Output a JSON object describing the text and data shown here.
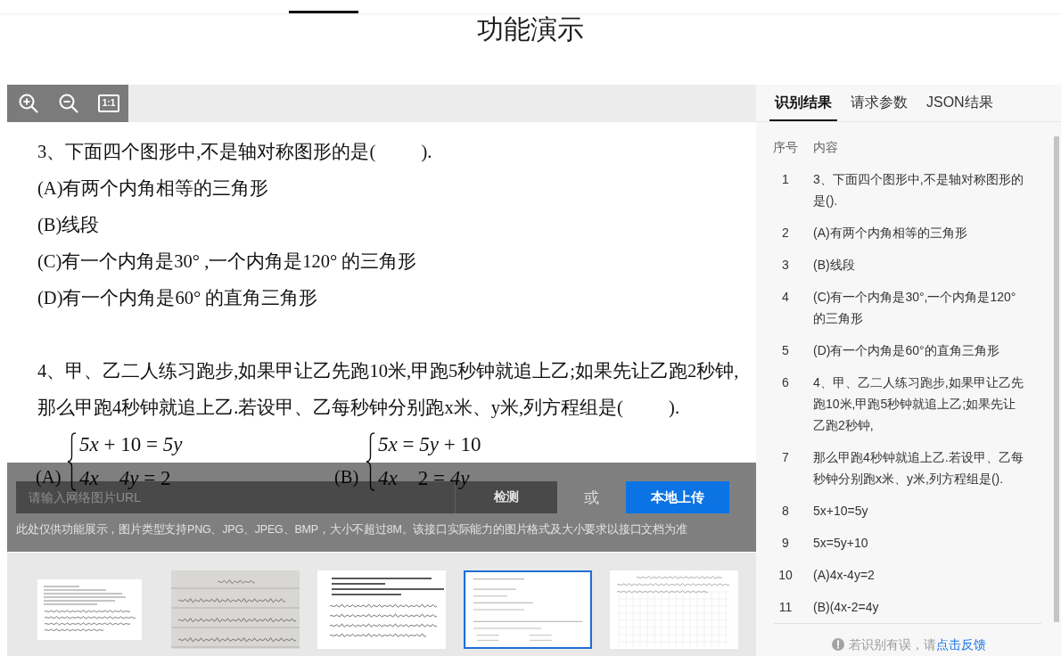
{
  "top_bar": {
    "active_tab_underline": true
  },
  "page_title": "功能演示",
  "viewer": {
    "toolbar": [
      {
        "kind": "zoom-in"
      },
      {
        "kind": "zoom-out"
      },
      {
        "kind": "actual-size",
        "label": "1:1"
      }
    ],
    "document": {
      "questions": [
        {
          "stem_lines": [
            "3、下面四个图形中,不是轴对称图形的是(          )."
          ],
          "options": [
            "(A)有两个内角相等的三角形",
            "(B)线段",
            "(C)有一个内角是30° ,一个内角是120° 的三角形",
            "(D)有一个内角是60° 的直角三角形"
          ]
        },
        {
          "stem_lines": [
            "4、甲、乙二人练习跑步,如果甲让乙先跑10米,甲跑5秒钟就追上乙;如果先让乙跑2秒钟,",
            "那么甲跑4秒钟就追上乙.若设甲、乙每秒钟分别跑x米、y米,列方程组是(          )."
          ],
          "systems": [
            {
              "label": "(A)",
              "equations": [
                "*5x* + 10 = *5y*",
                "*4x*    *4y* = 2"
              ]
            },
            {
              "label": "(B)",
              "equations": [
                "*5x* = *5y* + 10",
                "*4x*    2 = *4y*"
              ]
            }
          ]
        }
      ]
    },
    "upload_bar": {
      "url_input": {
        "placeholder": "请输入网络图片URL"
      },
      "detect_button": "检测",
      "or_text": "或",
      "upload_button": "本地上传",
      "notice": "此处仅供功能展示，图片类型支持PNG、JPG、JPEG、BMP，大小不超过8M。该接口实际能力的图片格式及大小要求以接口文档为准"
    },
    "samples": [
      {
        "kind": "handwritten-note",
        "selected": false
      },
      {
        "kind": "lined-paper",
        "selected": false
      },
      {
        "kind": "typed-essay",
        "selected": false
      },
      {
        "kind": "exam-page",
        "selected": true
      },
      {
        "kind": "grid-paper",
        "selected": false
      }
    ]
  },
  "results": {
    "tabs": [
      {
        "label": "识别结果",
        "selected": true
      },
      {
        "label": "请求参数",
        "selected": false
      },
      {
        "label": "JSON结果",
        "selected": false
      }
    ],
    "columns": [
      "序号",
      "内容"
    ],
    "rows": [
      {
        "index": "1",
        "content": "3、下面四个图形中,不是轴对称图形的是()."
      },
      {
        "index": "2",
        "content": "(A)有两个内角相等的三角形"
      },
      {
        "index": "3",
        "content": "(B)线段"
      },
      {
        "index": "4",
        "content": "(C)有一个内角是30°,一个内角是120°的三角形"
      },
      {
        "index": "5",
        "content": "(D)有一个内角是60°的直角三角形"
      },
      {
        "index": "6",
        "content": "4、甲、乙二人练习跑步,如果甲让乙先跑10米,甲跑5秒钟就追上乙;如果先让乙跑2秒钟,"
      },
      {
        "index": "7",
        "content": "那么甲跑4秒钟就追上乙.若设甲、乙每秒钟分别跑x米、y米,列方程组是()."
      },
      {
        "index": "8",
        "content": "5x+10=5y"
      },
      {
        "index": "9",
        "content": "5x=5y+10"
      },
      {
        "index": "10",
        "content": "(A)4x-4y=2"
      },
      {
        "index": "11",
        "content": "(B)(4x-2=4y"
      }
    ],
    "feedback": {
      "text": "若识别有误，请",
      "link": "点击反馈"
    }
  }
}
